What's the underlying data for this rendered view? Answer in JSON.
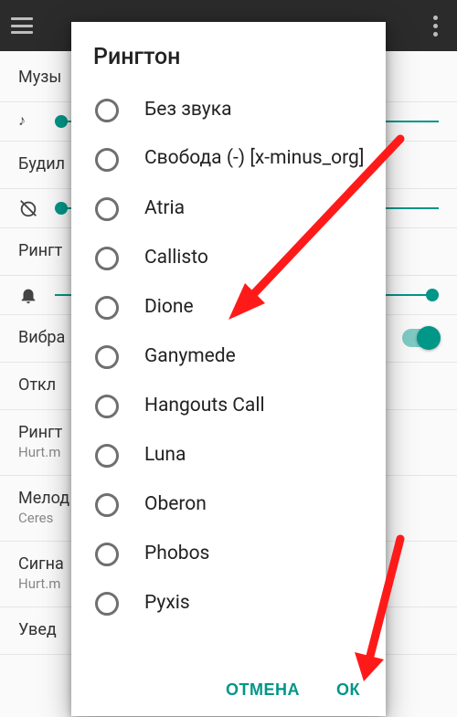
{
  "dialog": {
    "title": "Рингтон",
    "options": [
      "Без звука",
      "Свобода (-) [x-minus_org]",
      "Atria",
      "Callisto",
      "Dione",
      "Ganymede",
      "Hangouts Call",
      "Luna",
      "Oberon",
      "Phobos",
      "Pyxis"
    ],
    "cancel": "ОТМЕНА",
    "ok": "ОК"
  },
  "background": {
    "rows": {
      "music": "Музы",
      "alarm": "Будил",
      "ringtone": "Рингт",
      "vibration": "Вибра",
      "mute": "Откл",
      "ringtone2_title": "Рингт",
      "ringtone2_sub": "Hurt.m",
      "melody_title": "Мелод",
      "melody_sub": "Ceres",
      "signal_title": "Сигна",
      "signal_sub": "Hurt.m",
      "notify": "Увед"
    }
  },
  "colors": {
    "accent": "#009688",
    "arrow": "#ff1a1a"
  }
}
